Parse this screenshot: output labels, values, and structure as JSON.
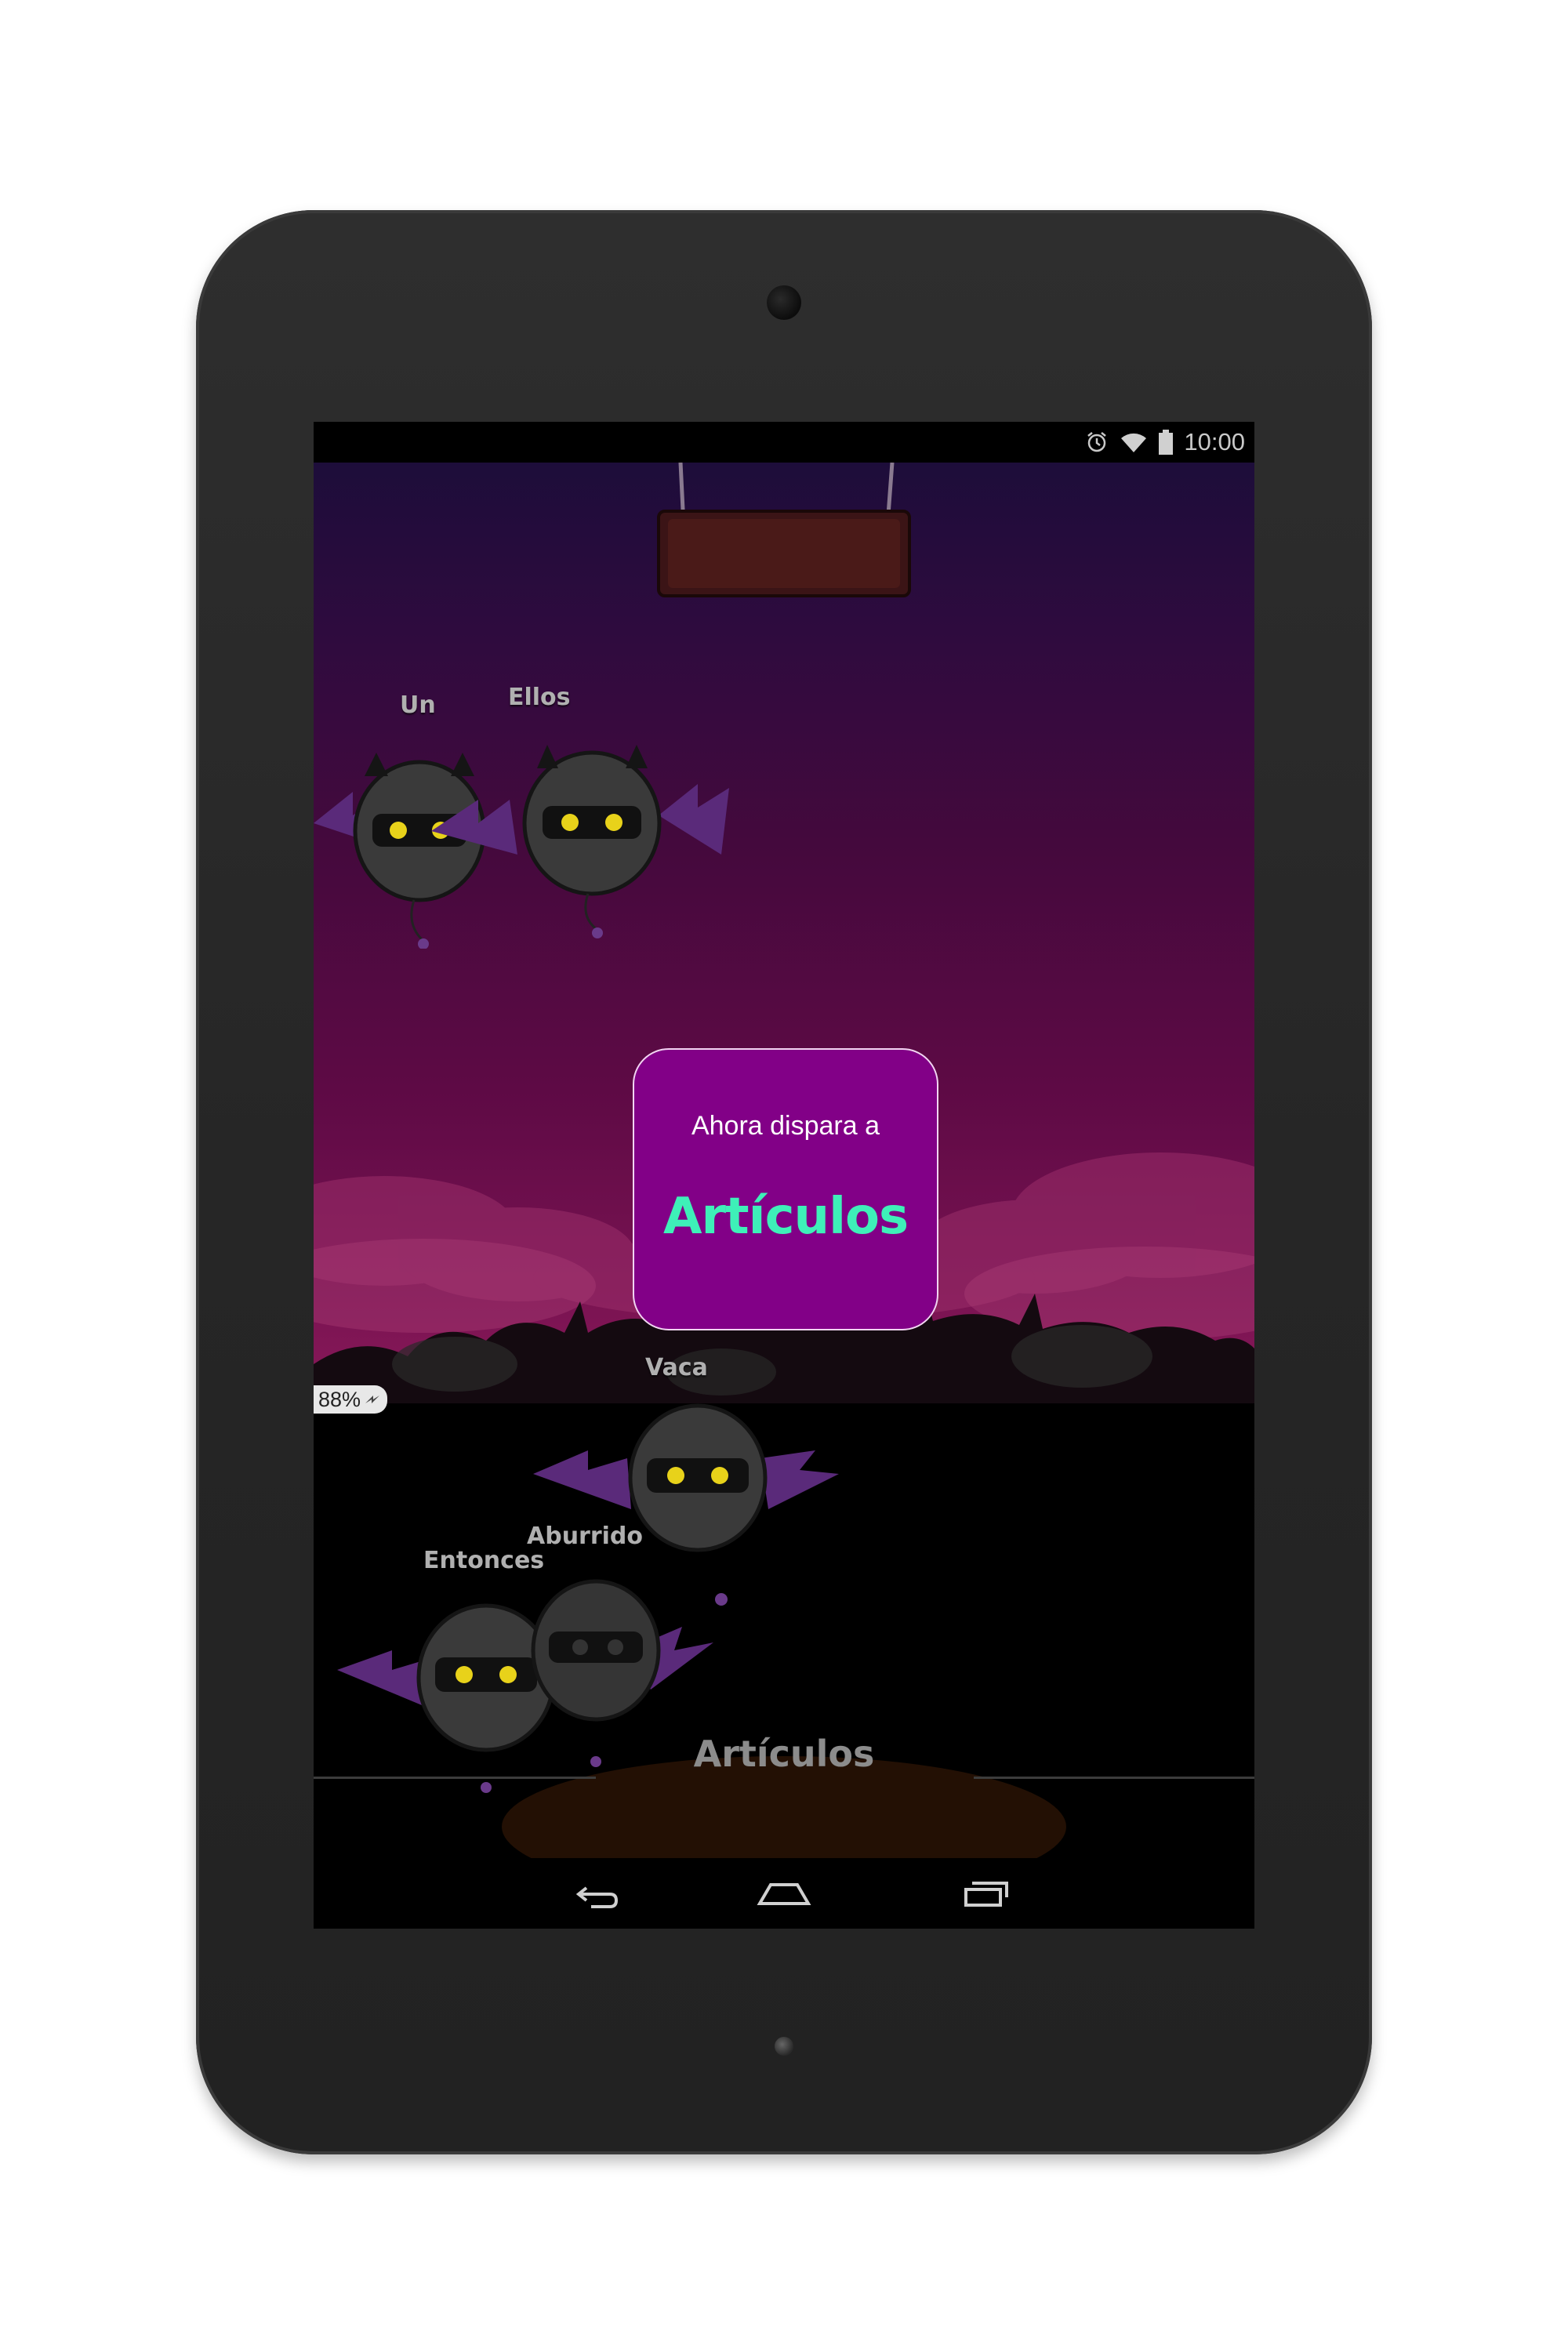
{
  "status_bar": {
    "time": "10:00",
    "icons": [
      "alarm-icon",
      "wifi-icon",
      "battery-icon"
    ]
  },
  "game": {
    "enemies": [
      {
        "word": "Un"
      },
      {
        "word": "Ellos"
      },
      {
        "word": "Vaca"
      },
      {
        "word": "Entonces"
      },
      {
        "word": "Aburrido"
      }
    ],
    "battery_badge": "88%",
    "dialog": {
      "prompt": "Ahora dispara a",
      "target": "Artículos"
    },
    "current_category": "Artículos",
    "colors": {
      "dialog_bg": "#820087",
      "target_text": "#3ef0b8"
    }
  },
  "nav_bar": {
    "icons": [
      "back-icon",
      "home-icon",
      "recents-icon"
    ]
  }
}
